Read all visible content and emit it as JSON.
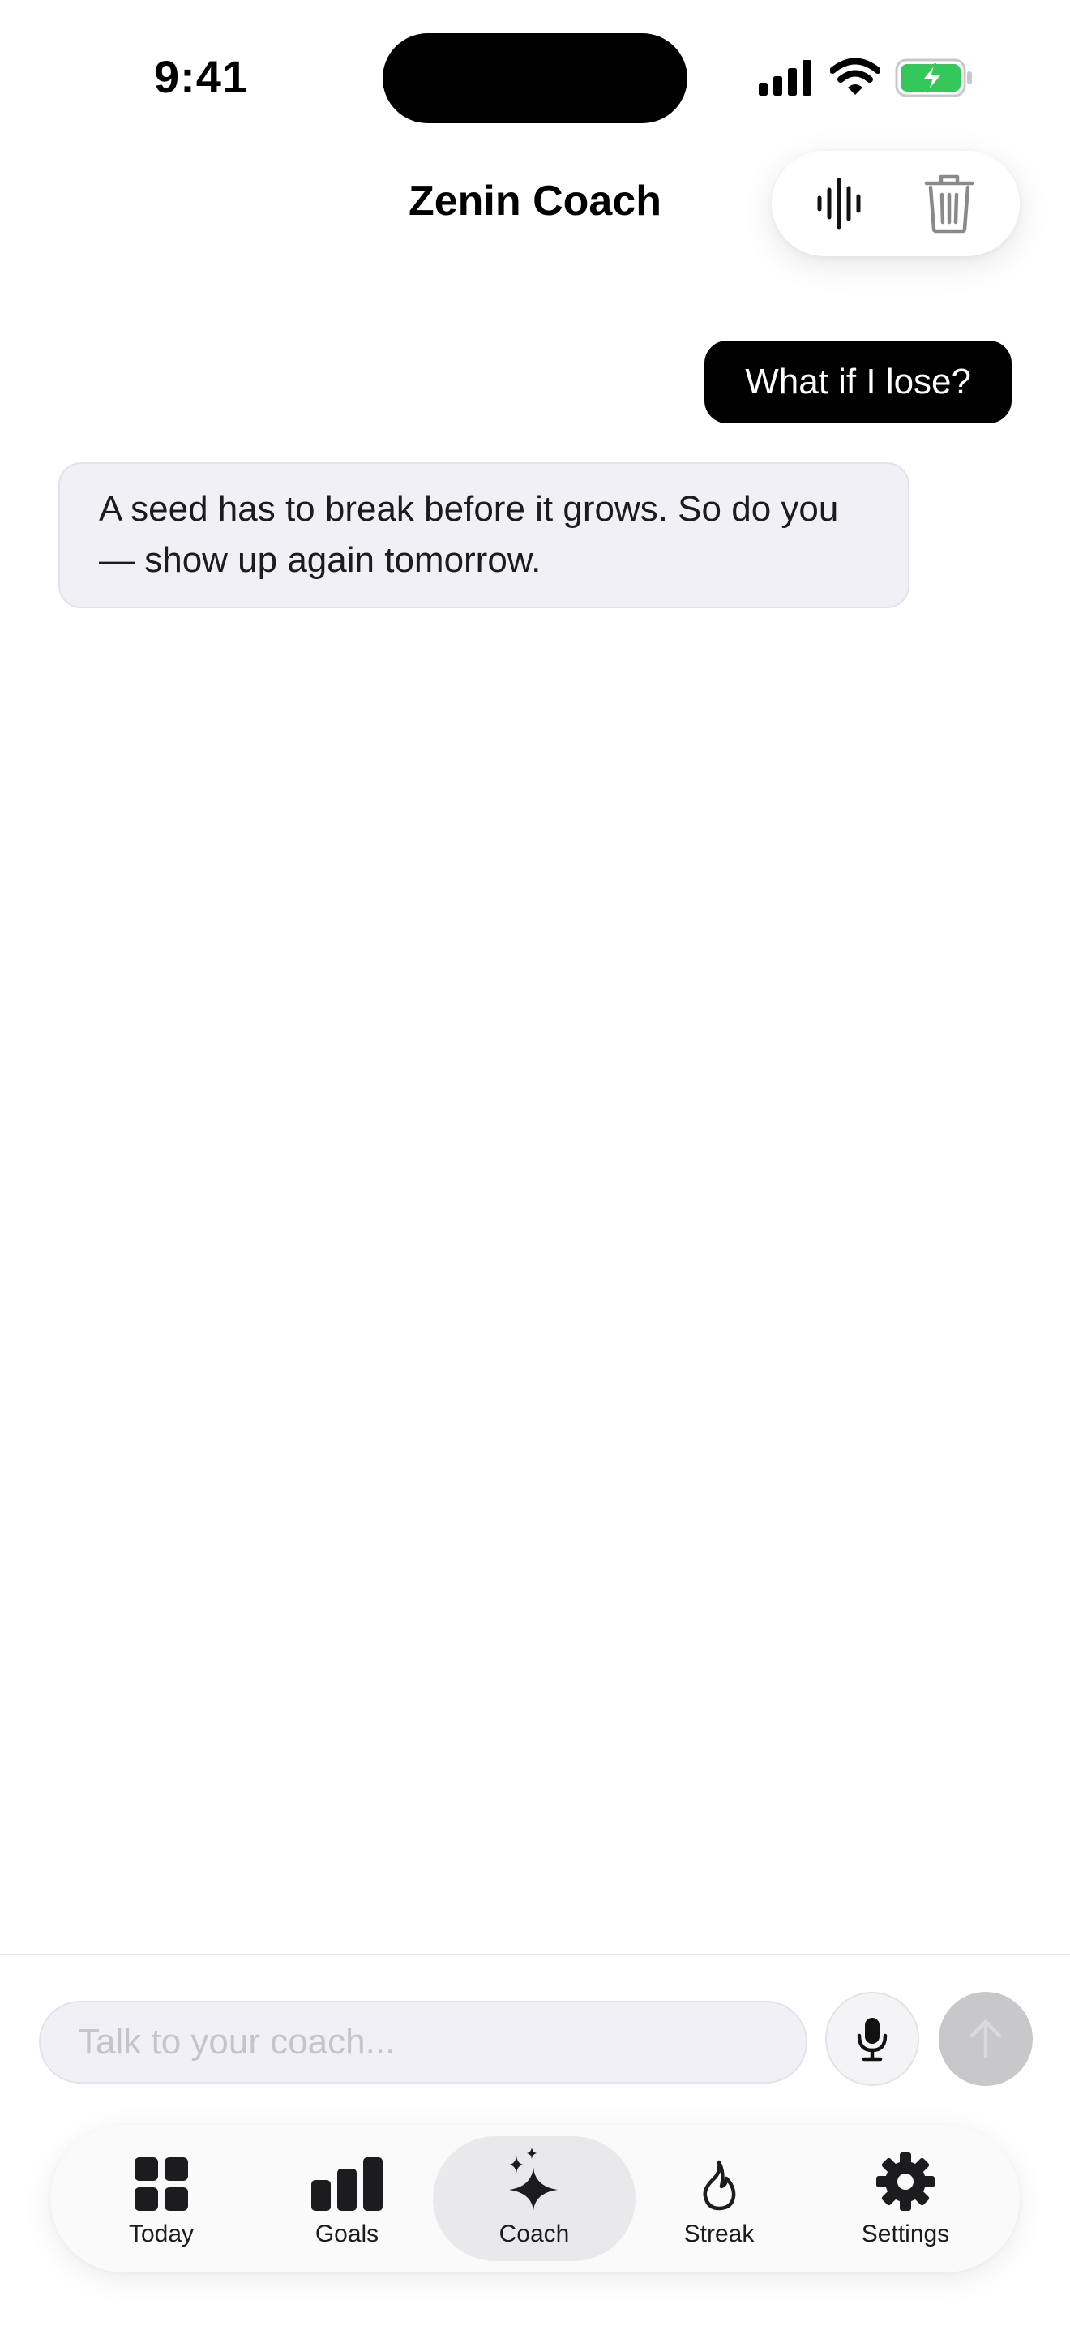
{
  "status_bar": {
    "time": "9:41",
    "icons": [
      "signal-icon",
      "wifi-icon",
      "battery-charging-icon"
    ],
    "battery_color": "#34c759"
  },
  "header": {
    "title": "Zenin Coach",
    "actions": [
      {
        "name": "voice",
        "icon": "waveform-icon"
      },
      {
        "name": "clear-chat",
        "icon": "trash-icon"
      }
    ]
  },
  "messages": [
    {
      "role": "user",
      "text": "What if I lose?"
    },
    {
      "role": "coach",
      "text": "A seed has to break before it grows. So do you — show up again tomorrow."
    }
  ],
  "composer": {
    "placeholder": "Talk to your coach...",
    "value": "",
    "mic_icon": "microphone-icon",
    "send_icon": "arrow-up-icon"
  },
  "tabs": [
    {
      "label": "Today",
      "icon": "grid-icon",
      "active": false
    },
    {
      "label": "Goals",
      "icon": "bar-chart-icon",
      "active": false
    },
    {
      "label": "Coach",
      "icon": "sparkles-icon",
      "active": true
    },
    {
      "label": "Streak",
      "icon": "flame-icon",
      "active": false
    },
    {
      "label": "Settings",
      "icon": "gear-icon",
      "active": false
    }
  ],
  "colors": {
    "accent": "#000000",
    "bubble_coach": "#f1f1f5",
    "send_disabled": "#c8c8cb"
  }
}
